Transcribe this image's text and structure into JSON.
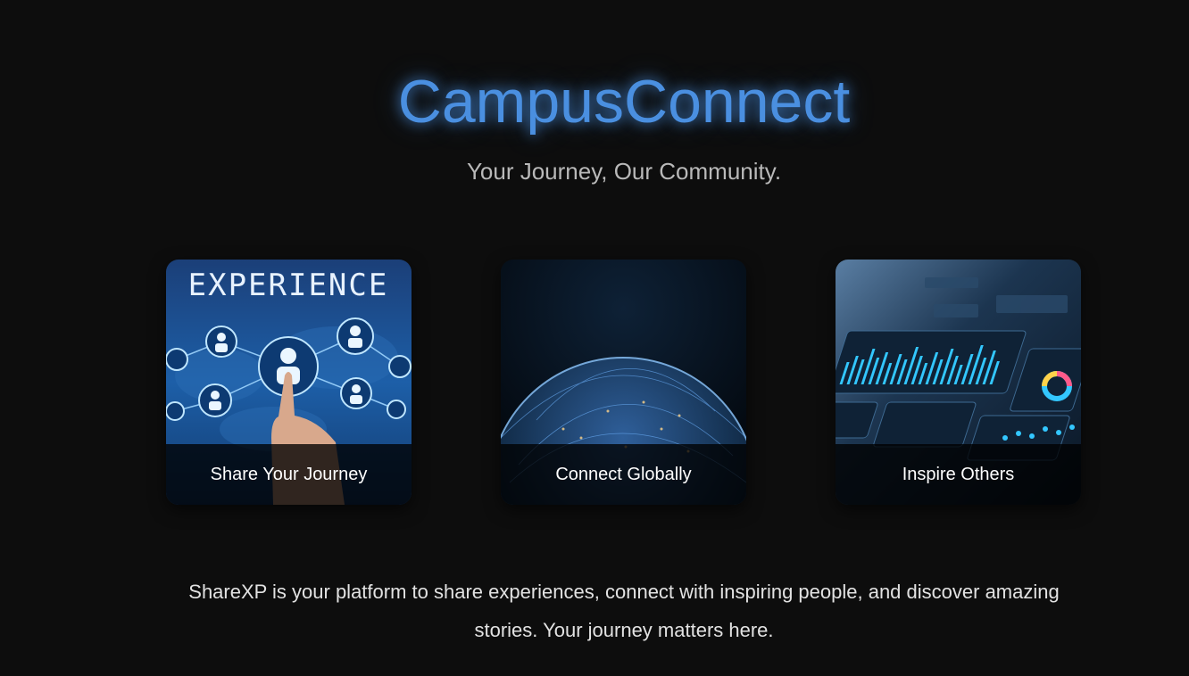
{
  "header": {
    "title": "CampusConnect",
    "tagline": "Your Journey, Our Community."
  },
  "cards": [
    {
      "label": "Share Your Journey",
      "image_text": "EXPERIENCE",
      "icon": "network-people-image"
    },
    {
      "label": "Connect Globally",
      "icon": "earth-globe-image"
    },
    {
      "label": "Inspire Others",
      "icon": "analytics-dashboard-image"
    }
  ],
  "description": "ShareXP is your platform to share experiences, connect with inspiring people, and discover amazing stories. Your journey matters here.",
  "colors": {
    "background": "#0d0d0d",
    "accent": "#4a8fe0",
    "caption_bg": "#000000"
  }
}
